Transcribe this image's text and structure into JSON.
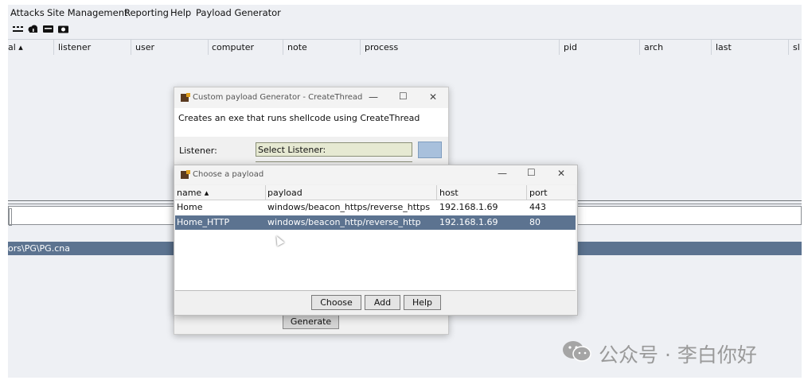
{
  "menubar": [
    "Attacks",
    "Site Management",
    "Reporting",
    "Help",
    "Payload Generator"
  ],
  "toolbar_icons": [
    "connections-icon",
    "cloud-icon",
    "keyboard-icon",
    "camera-icon"
  ],
  "sessions_table": {
    "columns": [
      "al ▴",
      "listener",
      "user",
      "computer",
      "note",
      "process",
      "pid",
      "arch",
      "last",
      "sl"
    ]
  },
  "script_path": "ors\\PG\\PG.cna",
  "generator_window": {
    "title": "Custom payload Generator - CreateThread",
    "description": "Creates an exe that runs shellcode using CreateThread",
    "listener_label": "Listener:",
    "listener_value": "Select Listener:",
    "generate_label": "Generate"
  },
  "payload_dialog": {
    "title": "Choose a payload",
    "columns": [
      "name ▴",
      "payload",
      "host",
      "port"
    ],
    "rows": [
      {
        "name": "Home",
        "payload": "windows/beacon_https/reverse_https",
        "host": "192.168.1.69",
        "port": "443"
      },
      {
        "name": "Home_HTTP",
        "payload": "windows/beacon_http/reverse_http",
        "host": "192.168.1.69",
        "port": "80"
      }
    ],
    "selected_row": 1,
    "buttons": {
      "choose": "Choose",
      "add": "Add",
      "help": "Help"
    }
  },
  "window_controls": {
    "minimize": "—",
    "maximize": "☐",
    "close": "✕"
  },
  "watermark": "公众号 · 李白你好",
  "colors": {
    "selection": "#5c7390",
    "listener_field": "#e6e9d2",
    "background": "#eef0f4"
  }
}
